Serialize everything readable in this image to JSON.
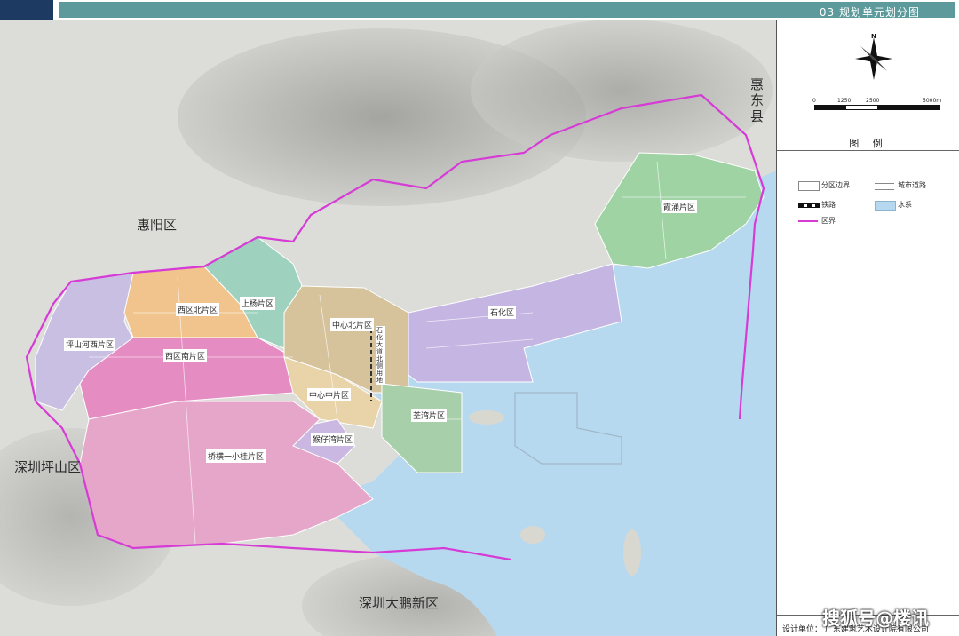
{
  "header": {
    "title": "03 规划单元划分图"
  },
  "map": {
    "regions": {
      "huiyang": "惠阳区",
      "huidong": "惠东县",
      "pingshan": "深圳坪山区",
      "dapeng": "深圳大鹏新区"
    },
    "districts": {
      "pingshanhe_west": "坪山河西片区",
      "xiqu_north": "西区北片区",
      "xiqu_south": "西区南片区",
      "shangyang": "上杨片区",
      "zhongxin_north": "中心北片区",
      "zhongxin_middle": "中心中片区",
      "ezhou": "荃湾片区",
      "shihua": "石化区",
      "xiayong": "霞涌片区",
      "xiaoyiqin": "猴仔湾片区",
      "qiaoheng": "桥横一小桂片区",
      "vertical_note": "石化大道北侧用地"
    },
    "colors": {
      "water": "#b7d9ef",
      "district_orange": "#f1c48e",
      "district_pink": "#e58cc2",
      "district_lavender": "#c9bfe3",
      "district_teal": "#9fd1bf",
      "district_tan": "#d6c39c",
      "district_green": "#9fd3a3",
      "district_purple": "#b6a7dc",
      "boundary_magenta": "#d63bd6"
    }
  },
  "compass": {
    "north_label": "N",
    "scale": [
      "0",
      "1250",
      "2500",
      "5000m"
    ]
  },
  "legend": {
    "title": "图  例",
    "items": [
      {
        "label": "分区边界",
        "icon": "district-boundary-icon"
      },
      {
        "label": "城市道路",
        "icon": "urban-road-icon"
      },
      {
        "label": "铁路",
        "icon": "railway-icon"
      },
      {
        "label": "水系",
        "icon": "water-system-icon"
      },
      {
        "label": "区界",
        "icon": "district-border-icon"
      }
    ]
  },
  "footer": {
    "credit_label": "设计单位：",
    "credit_org": "广东建筑艺术设计院有限公司",
    "watermark": "搜狐号@楼讯"
  }
}
